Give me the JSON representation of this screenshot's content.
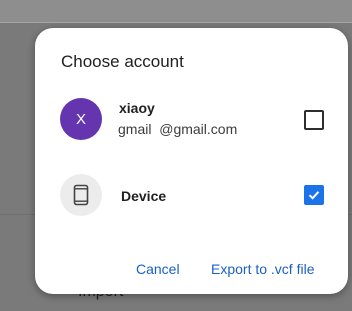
{
  "background": {
    "import_label": "Import"
  },
  "dialog": {
    "title": "Choose account",
    "accounts": [
      {
        "avatar_letter": "X",
        "avatar_color": "#6435ae",
        "name": "xiaoy",
        "email": "gmail  @gmail.com",
        "checked": false
      },
      {
        "icon": "phone-icon",
        "name": "Device",
        "checked": true
      }
    ],
    "cancel_label": "Cancel",
    "export_label": "Export to .vcf file",
    "accent_color": "#1a73e8"
  }
}
